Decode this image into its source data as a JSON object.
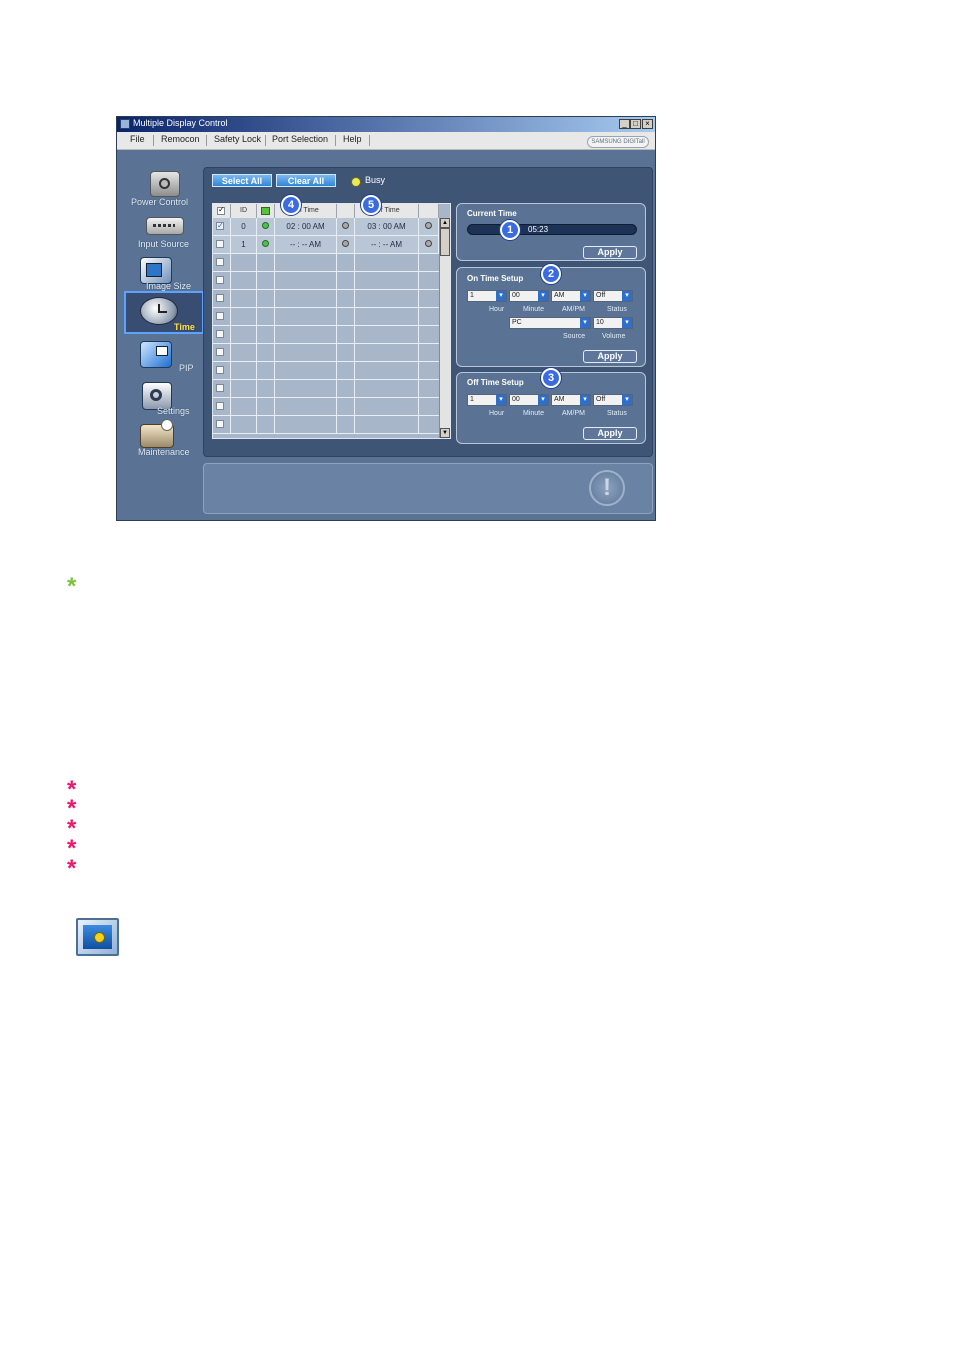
{
  "window": {
    "title": "Multiple Display Control",
    "logo": "SAMSUNG DIGITall",
    "controls": [
      "_",
      "□",
      "×"
    ]
  },
  "menu": {
    "items": [
      "File",
      "Remocon",
      "Safety Lock",
      "Port Selection",
      "Help"
    ]
  },
  "sidebar": {
    "items": [
      {
        "label": "Power Control",
        "icon": "power-control-icon"
      },
      {
        "label": "Input Source",
        "icon": "input-source-icon"
      },
      {
        "label": "Image Size",
        "icon": "image-size-icon"
      },
      {
        "label": "Time",
        "icon": "clock-icon",
        "selected": true
      },
      {
        "label": "PIP",
        "icon": "pip-icon"
      },
      {
        "label": "Settings",
        "icon": "settings-icon"
      },
      {
        "label": "Maintenance",
        "icon": "maintenance-icon"
      }
    ]
  },
  "toolbar": {
    "select_all": "Select All",
    "clear_all": "Clear All",
    "busy": "Busy"
  },
  "grid": {
    "headers": [
      "ID",
      "On Time",
      "Off Time"
    ],
    "rows": [
      {
        "id": "0",
        "on_time": "02 : 00 AM",
        "off_time": "03 : 00 AM",
        "checked": true
      },
      {
        "id": "1",
        "on_time": "-- : -- AM",
        "off_time": "-- : -- AM",
        "checked": false
      }
    ],
    "empty_rows": 10
  },
  "current_time": {
    "title": "Current Time",
    "value": "05:23",
    "apply": "Apply"
  },
  "on_time_setup": {
    "title": "On Time Setup",
    "hour": "1",
    "minute": "00",
    "ampm": "AM",
    "status": "Off",
    "source": "PC",
    "volume": "10",
    "labels": {
      "hour": "Hour",
      "minute": "Minute",
      "ampm": "AM/PM",
      "status": "Status",
      "source": "Source",
      "volume": "Volume"
    },
    "apply": "Apply"
  },
  "off_time_setup": {
    "title": "Off Time Setup",
    "hour": "1",
    "minute": "00",
    "ampm": "AM",
    "status": "Off",
    "labels": {
      "hour": "Hour",
      "minute": "Minute",
      "ampm": "AM/PM",
      "status": "Status"
    },
    "apply": "Apply"
  },
  "badges": [
    "1",
    "2",
    "3",
    "4",
    "5"
  ],
  "colors": {
    "green_star": "#7cc242",
    "pink_star": "#e8196b",
    "led_busy": "#e8e85a",
    "led_on": "#4cc14c"
  },
  "icons": {
    "note_green": "asterisk-green-icon",
    "note_pink": "asterisk-pink-icon",
    "pip_thumbnail": "pip-monitor-icon",
    "info": "exclamation-icon"
  }
}
